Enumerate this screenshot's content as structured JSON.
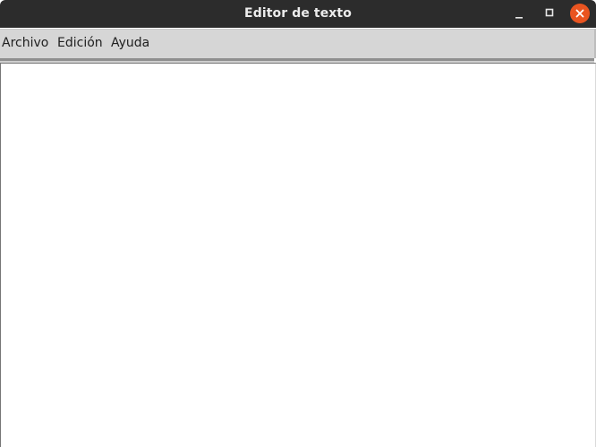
{
  "window": {
    "title": "Editor de texto",
    "controls": {
      "minimize_icon": "minimize-icon",
      "maximize_icon": "maximize-icon",
      "close_icon": "close-icon",
      "close_color": "#e95420"
    }
  },
  "menubar": {
    "items": [
      {
        "label": "Archivo"
      },
      {
        "label": "Edición"
      },
      {
        "label": "Ayuda"
      }
    ]
  },
  "editor": {
    "content": ""
  },
  "colors": {
    "titlebar": "#2c2c2c",
    "menubar": "#d6d6d6",
    "accent": "#e95420"
  }
}
